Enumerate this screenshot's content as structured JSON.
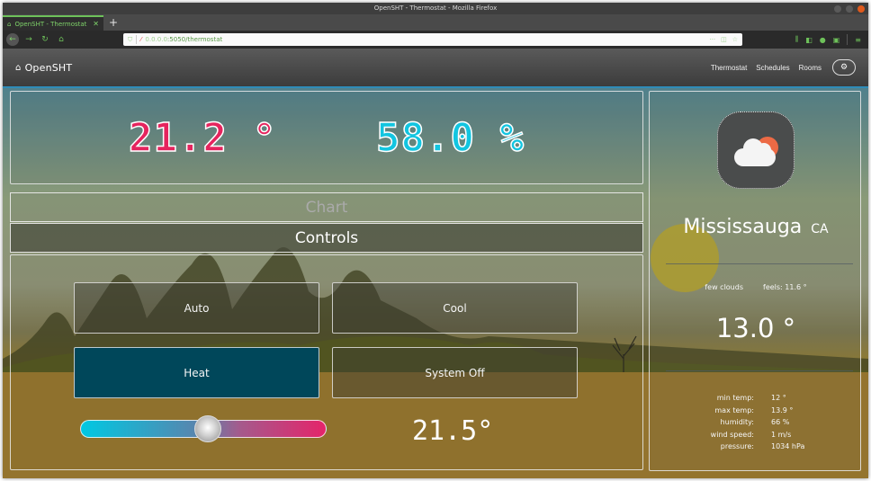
{
  "browser": {
    "window_title": "OpenSHT - Thermostat - Mozilla Firefox",
    "tab_title": "OpenSHT - Thermostat",
    "url_host": "0.0.0.0",
    "url_path": ":5050/thermostat"
  },
  "app": {
    "brand": "OpenSHT",
    "nav": [
      {
        "label": "Thermostat"
      },
      {
        "label": "Schedules"
      },
      {
        "label": "Rooms"
      }
    ]
  },
  "readings": {
    "temperature": "21.2 °",
    "humidity": "58.0 %"
  },
  "tabs": {
    "chart": "Chart",
    "controls": "Controls"
  },
  "controls": {
    "modes": {
      "auto": "Auto",
      "cool": "Cool",
      "heat": "Heat",
      "off": "System Off"
    },
    "active_mode": "heat",
    "setpoint": "21.5°",
    "slider_fraction": 0.52
  },
  "weather": {
    "city": "Mississauga",
    "country": "CA",
    "description": "few clouds",
    "feels_like": "feels: 11.6 °",
    "temperature": "13.0 °",
    "stats": [
      {
        "label": "min temp:",
        "value": "12 °"
      },
      {
        "label": "max temp:",
        "value": "13.9 °"
      },
      {
        "label": "humidity:",
        "value": "66 %"
      },
      {
        "label": "wind speed:",
        "value": "1 m/s"
      },
      {
        "label": "pressure:",
        "value": "1034 hPa"
      }
    ]
  },
  "colors": {
    "temperature": "#e5245e",
    "humidity": "#12c5e0",
    "active_button": "#00475a",
    "weather_sun": "#ec6a45"
  }
}
